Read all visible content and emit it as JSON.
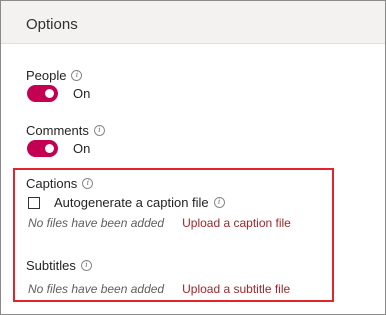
{
  "header": {
    "title": "Options"
  },
  "people": {
    "label": "People",
    "toggle_state": "On"
  },
  "comments": {
    "label": "Comments",
    "toggle_state": "On"
  },
  "captions": {
    "label": "Captions",
    "autogenerate_label": "Autogenerate a caption file",
    "empty_text": "No files have been added",
    "upload_link": "Upload a caption file"
  },
  "subtitles": {
    "label": "Subtitles",
    "empty_text": "No files have been added",
    "upload_link": "Upload a subtitle file"
  },
  "info_icon_glyph": "i",
  "colors": {
    "toggle_on": "#c30052",
    "link": "#a4262c",
    "highlight": "#e0252b"
  }
}
